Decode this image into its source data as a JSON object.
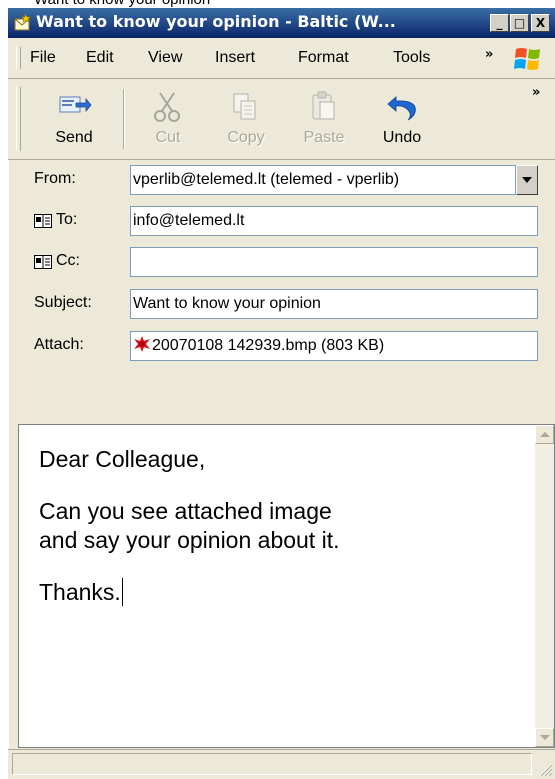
{
  "top_strip_text": "Want to know your opinion",
  "window": {
    "title": "Want to know your opinion - Baltic (W...",
    "controls": {
      "minimize": "_",
      "maximize": "□",
      "close": "X"
    }
  },
  "menu": {
    "items": [
      "File",
      "Edit",
      "View",
      "Insert",
      "Format",
      "Tools"
    ],
    "overflow": "»"
  },
  "toolbar": {
    "buttons": [
      {
        "label": "Send",
        "icon": "send-icon",
        "enabled": true
      },
      {
        "label": "Cut",
        "icon": "scissors-icon",
        "enabled": false
      },
      {
        "label": "Copy",
        "icon": "copy-icon",
        "enabled": false
      },
      {
        "label": "Paste",
        "icon": "clipboard-icon",
        "enabled": false
      },
      {
        "label": "Undo",
        "icon": "undo-arrow-icon",
        "enabled": true
      }
    ],
    "overflow": "»"
  },
  "header": {
    "from_label": "From:",
    "from_value": "vperlib@telemed.lt   (telemed - vperlib)",
    "to_label": "To:",
    "to_value": "info@telemed.lt",
    "cc_label": "Cc:",
    "cc_value": "",
    "subject_label": "Subject:",
    "subject_value": "Want to know your opinion",
    "attach_label": "Attach:",
    "attachment": "20070108 142939.bmp (803 KB)"
  },
  "message": {
    "greeting": "Dear Colleague,",
    "line1": "Can you see attached image",
    "line2": "and say your opinion about it.",
    "closing": "Thanks."
  },
  "colors": {
    "titlebar_start": "#3a6ea5",
    "titlebar_end": "#0a246a",
    "chrome": "#ece9d8",
    "field_border": "#7f9db9"
  }
}
